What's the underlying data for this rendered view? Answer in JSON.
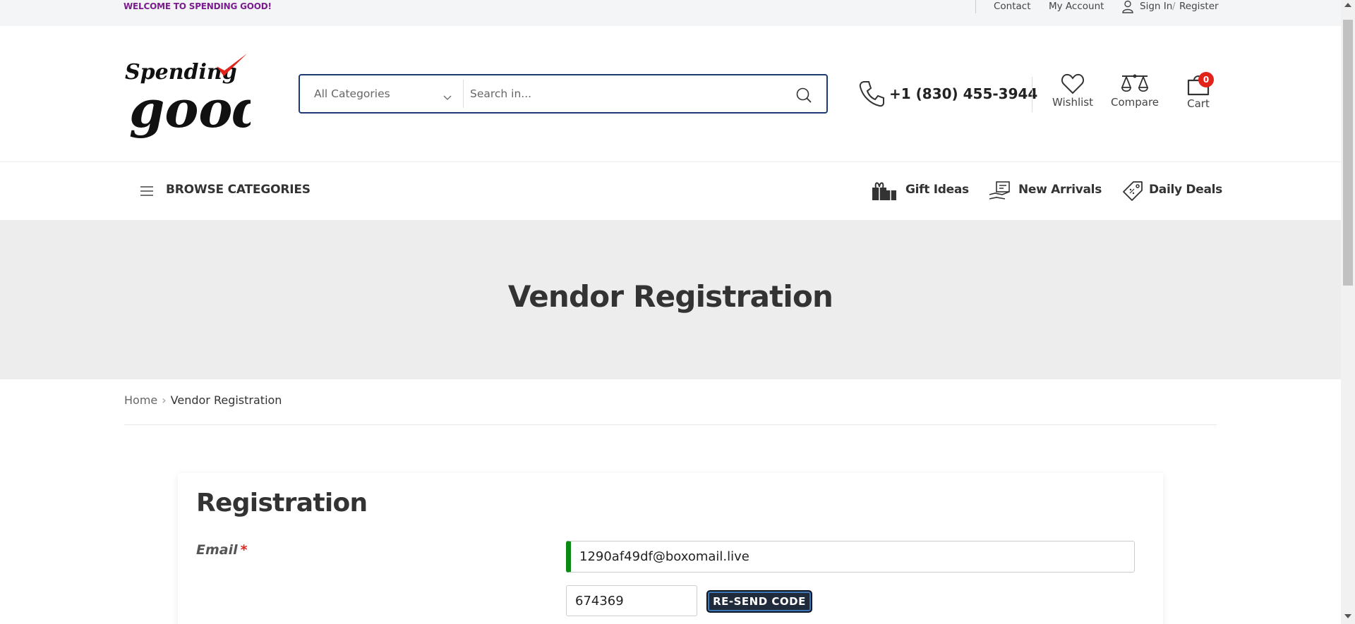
{
  "topbar": {
    "welcome": "WELCOME TO SPENDING GOOD!",
    "contact": "Contact",
    "my_account": "My Account",
    "sign_in": "Sign In",
    "separator": "/",
    "register": "Register"
  },
  "header": {
    "logo_text_top": "Spending",
    "logo_text_bottom": "good",
    "category_select": "All Categories",
    "search_placeholder": "Search in...",
    "phone": "+1 (830) 455-3944",
    "wishlist": "Wishlist",
    "compare": "Compare",
    "cart": "Cart",
    "cart_count": "0"
  },
  "nav": {
    "browse": "BROWSE CATEGORIES",
    "links": [
      "Gift Ideas",
      "New Arrivals",
      "Daily Deals"
    ]
  },
  "hero": {
    "title": "Vendor Registration"
  },
  "breadcrumb": {
    "home": "Home",
    "arrow": "›",
    "current": "Vendor Registration"
  },
  "form": {
    "title": "Registration",
    "email_label": "Email",
    "required_mark": "*",
    "email_value": "1290af49df@boxomail.live",
    "code_value": "674369",
    "resend_label": "RE-SEND CODE"
  },
  "colors": {
    "brand_purple": "#7a1d8f",
    "search_border": "#1d3b73",
    "badge_red": "#e2231a",
    "valid_green": "#0a8a12",
    "button_dark": "#1f2a3a"
  }
}
